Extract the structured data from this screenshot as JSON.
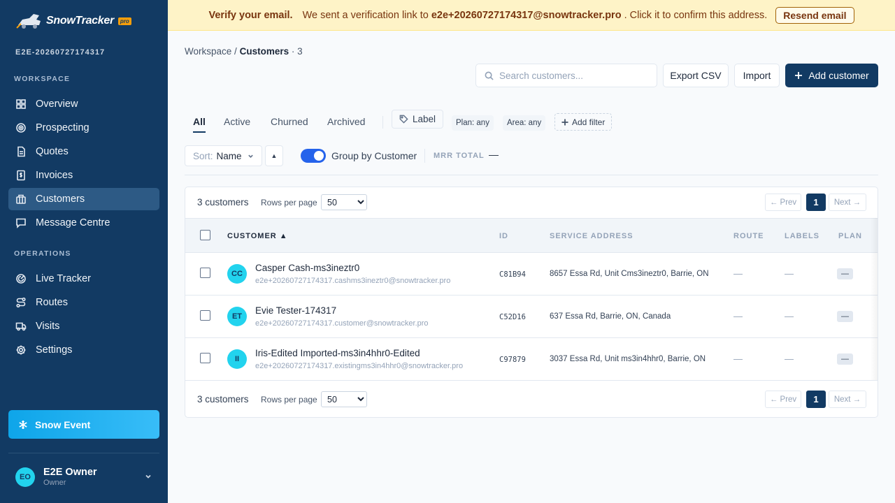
{
  "brand": {
    "name": "SnowTracker",
    "badge": "pro"
  },
  "tenant": "E2E-20260727174317",
  "sidebar": {
    "workspace_label": "WORKSPACE",
    "workspace_items": [
      {
        "label": "Overview",
        "icon": "grid-icon"
      },
      {
        "label": "Prospecting",
        "icon": "target-icon"
      },
      {
        "label": "Quotes",
        "icon": "document-icon"
      },
      {
        "label": "Invoices",
        "icon": "invoice-icon"
      },
      {
        "label": "Customers",
        "icon": "building-icon",
        "active": true
      },
      {
        "label": "Message Centre",
        "icon": "chat-icon"
      }
    ],
    "operations_label": "OPERATIONS",
    "operations_items": [
      {
        "label": "Live Tracker",
        "icon": "radar-icon"
      },
      {
        "label": "Routes",
        "icon": "route-icon"
      },
      {
        "label": "Visits",
        "icon": "truck-icon"
      },
      {
        "label": "Settings",
        "icon": "gear-icon"
      }
    ],
    "snow_event_label": "Snow Event",
    "user": {
      "initials": "EO",
      "name": "E2E Owner",
      "role": "Owner"
    }
  },
  "banner": {
    "title": "Verify your email.",
    "pre": "We sent a verification link to",
    "email": "e2e+20260727174317@snowtracker.pro",
    "post": ". Click it to confirm this address.",
    "button": "Resend email"
  },
  "breadcrumb": {
    "root": "Workspace",
    "sep": "/",
    "current": "Customers",
    "count": "· 3"
  },
  "toolbar": {
    "search_placeholder": "Search customers...",
    "export_label": "Export CSV",
    "import_label": "Import",
    "add_label": "Add customer"
  },
  "tabs": [
    "All",
    "Active",
    "Churned",
    "Archived"
  ],
  "filters": {
    "label_chip": "Label",
    "plan": "Plan: any",
    "area": "Area: any",
    "add_filter": "Add filter"
  },
  "sort": {
    "prefix": "Sort:",
    "value": "Name",
    "direction": "▲"
  },
  "group_toggle": {
    "label": "Group by Customer",
    "on": true
  },
  "mrr": {
    "label": "MRR TOTAL",
    "value": "—"
  },
  "table": {
    "count_text": "3 customers",
    "rows_per_page_label": "Rows per page",
    "rows_per_page": "50",
    "prev": "← Prev",
    "page": "1",
    "next": "Next →",
    "columns": [
      "CUSTOMER ▲",
      "ID",
      "SERVICE ADDRESS",
      "ROUTE",
      "LABELS",
      "PLAN"
    ],
    "rows": [
      {
        "initials": "CC",
        "name": "Casper Cash-ms3ineztr0",
        "email": "e2e+20260727174317.cashms3ineztr0@snowtracker.pro",
        "id": "C81B94",
        "address": "8657 Essa Rd, Unit Cms3ineztr0, Barrie, ON",
        "route": "—",
        "labels": "—",
        "plan": "—"
      },
      {
        "initials": "ET",
        "name": "Evie Tester-174317",
        "email": "e2e+20260727174317.customer@snowtracker.pro",
        "id": "C52D16",
        "address": "637 Essa Rd, Barrie, ON, Canada",
        "route": "—",
        "labels": "—",
        "plan": "—"
      },
      {
        "initials": "II",
        "name": "Iris-Edited Imported-ms3in4hhr0-Edited",
        "email": "e2e+20260727174317.existingms3in4hhr0@snowtracker.pro",
        "id": "C97879",
        "address": "3037 Essa Rd, Unit ms3in4hhr0, Barrie, ON",
        "route": "—",
        "labels": "—",
        "plan": "—"
      }
    ]
  },
  "colors": {
    "sidebar": "#123a63",
    "accent": "#2563eb",
    "avatar": "#22d3ee",
    "banner": "#fef3c7"
  }
}
